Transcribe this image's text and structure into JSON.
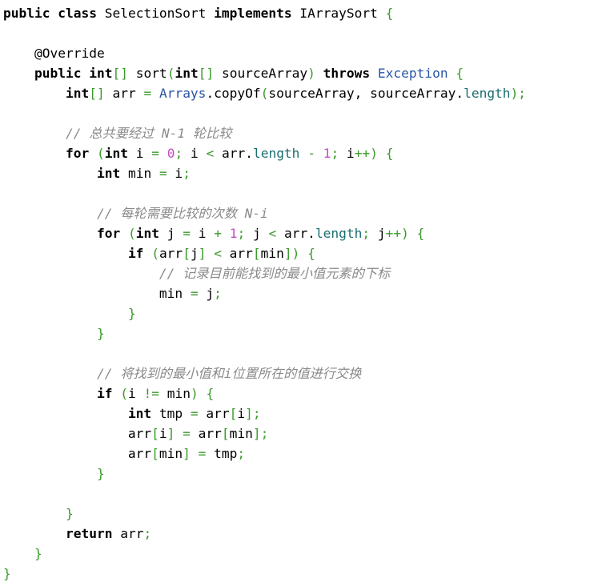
{
  "document": {
    "language": "java",
    "lines": [
      [
        [
          "kw",
          "public"
        ],
        [
          "id",
          " "
        ],
        [
          "kw",
          "class"
        ],
        [
          "id",
          " SelectionSort "
        ],
        [
          "kw",
          "implements"
        ],
        [
          "id",
          " IArraySort "
        ],
        [
          "pn",
          "{"
        ]
      ],
      [],
      [
        [
          "id",
          "    "
        ],
        [
          "an",
          "@Override"
        ]
      ],
      [
        [
          "id",
          "    "
        ],
        [
          "kw",
          "public"
        ],
        [
          "id",
          " "
        ],
        [
          "kw",
          "int"
        ],
        [
          "pn",
          "[]"
        ],
        [
          "id",
          " sort"
        ],
        [
          "pn",
          "("
        ],
        [
          "kw",
          "int"
        ],
        [
          "pn",
          "[]"
        ],
        [
          "id",
          " sourceArray"
        ],
        [
          "pn",
          ")"
        ],
        [
          "id",
          " "
        ],
        [
          "kw",
          "throws"
        ],
        [
          "id",
          " "
        ],
        [
          "ty",
          "Exception"
        ],
        [
          "id",
          " "
        ],
        [
          "pn",
          "{"
        ]
      ],
      [
        [
          "id",
          "        "
        ],
        [
          "kw",
          "int"
        ],
        [
          "pn",
          "[]"
        ],
        [
          "id",
          " arr "
        ],
        [
          "op",
          "="
        ],
        [
          "id",
          " "
        ],
        [
          "ty",
          "Arrays"
        ],
        [
          "id",
          ".copyOf"
        ],
        [
          "pn",
          "("
        ],
        [
          "id",
          "sourceArray, sourceArray."
        ],
        [
          "fld",
          "length"
        ],
        [
          "pn",
          ");"
        ]
      ],
      [],
      [
        [
          "id",
          "        "
        ],
        [
          "cm",
          "// 总共要经过 N-1 轮比较"
        ]
      ],
      [
        [
          "id",
          "        "
        ],
        [
          "kw",
          "for"
        ],
        [
          "id",
          " "
        ],
        [
          "pn",
          "("
        ],
        [
          "kw",
          "int"
        ],
        [
          "id",
          " i "
        ],
        [
          "op",
          "="
        ],
        [
          "id",
          " "
        ],
        [
          "num",
          "0"
        ],
        [
          "pn",
          ";"
        ],
        [
          "id",
          " i "
        ],
        [
          "op",
          "<"
        ],
        [
          "id",
          " arr."
        ],
        [
          "fld",
          "length"
        ],
        [
          "id",
          " "
        ],
        [
          "op",
          "-"
        ],
        [
          "id",
          " "
        ],
        [
          "num",
          "1"
        ],
        [
          "pn",
          ";"
        ],
        [
          "id",
          " i"
        ],
        [
          "op",
          "++"
        ],
        [
          "pn",
          ")"
        ],
        [
          "id",
          " "
        ],
        [
          "pn",
          "{"
        ]
      ],
      [
        [
          "id",
          "            "
        ],
        [
          "kw",
          "int"
        ],
        [
          "id",
          " min "
        ],
        [
          "op",
          "="
        ],
        [
          "id",
          " i"
        ],
        [
          "pn",
          ";"
        ]
      ],
      [],
      [
        [
          "id",
          "            "
        ],
        [
          "cm",
          "// 每轮需要比较的次数 N-i"
        ]
      ],
      [
        [
          "id",
          "            "
        ],
        [
          "kw",
          "for"
        ],
        [
          "id",
          " "
        ],
        [
          "pn",
          "("
        ],
        [
          "kw",
          "int"
        ],
        [
          "id",
          " j "
        ],
        [
          "op",
          "="
        ],
        [
          "id",
          " i "
        ],
        [
          "op",
          "+"
        ],
        [
          "id",
          " "
        ],
        [
          "num",
          "1"
        ],
        [
          "pn",
          ";"
        ],
        [
          "id",
          " j "
        ],
        [
          "op",
          "<"
        ],
        [
          "id",
          " arr."
        ],
        [
          "fld",
          "length"
        ],
        [
          "pn",
          ";"
        ],
        [
          "id",
          " j"
        ],
        [
          "op",
          "++"
        ],
        [
          "pn",
          ")"
        ],
        [
          "id",
          " "
        ],
        [
          "pn",
          "{"
        ]
      ],
      [
        [
          "id",
          "                "
        ],
        [
          "kw",
          "if"
        ],
        [
          "id",
          " "
        ],
        [
          "pn",
          "("
        ],
        [
          "id",
          "arr"
        ],
        [
          "pn",
          "["
        ],
        [
          "id",
          "j"
        ],
        [
          "pn",
          "]"
        ],
        [
          "id",
          " "
        ],
        [
          "op",
          "<"
        ],
        [
          "id",
          " arr"
        ],
        [
          "pn",
          "["
        ],
        [
          "id",
          "min"
        ],
        [
          "pn",
          "])"
        ],
        [
          "id",
          " "
        ],
        [
          "pn",
          "{"
        ]
      ],
      [
        [
          "id",
          "                    "
        ],
        [
          "cm",
          "// 记录目前能找到的最小值元素的下标"
        ]
      ],
      [
        [
          "id",
          "                    min "
        ],
        [
          "op",
          "="
        ],
        [
          "id",
          " j"
        ],
        [
          "pn",
          ";"
        ]
      ],
      [
        [
          "id",
          "                "
        ],
        [
          "pn",
          "}"
        ]
      ],
      [
        [
          "id",
          "            "
        ],
        [
          "pn",
          "}"
        ]
      ],
      [],
      [
        [
          "id",
          "            "
        ],
        [
          "cm",
          "// 将找到的最小值和i位置所在的值进行交换"
        ]
      ],
      [
        [
          "id",
          "            "
        ],
        [
          "kw",
          "if"
        ],
        [
          "id",
          " "
        ],
        [
          "pn",
          "("
        ],
        [
          "id",
          "i "
        ],
        [
          "op",
          "!="
        ],
        [
          "id",
          " min"
        ],
        [
          "pn",
          ")"
        ],
        [
          "id",
          " "
        ],
        [
          "pn",
          "{"
        ]
      ],
      [
        [
          "id",
          "                "
        ],
        [
          "kw",
          "int"
        ],
        [
          "id",
          " tmp "
        ],
        [
          "op",
          "="
        ],
        [
          "id",
          " arr"
        ],
        [
          "pn",
          "["
        ],
        [
          "id",
          "i"
        ],
        [
          "pn",
          "];"
        ]
      ],
      [
        [
          "id",
          "                arr"
        ],
        [
          "pn",
          "["
        ],
        [
          "id",
          "i"
        ],
        [
          "pn",
          "]"
        ],
        [
          "id",
          " "
        ],
        [
          "op",
          "="
        ],
        [
          "id",
          " arr"
        ],
        [
          "pn",
          "["
        ],
        [
          "id",
          "min"
        ],
        [
          "pn",
          "];"
        ]
      ],
      [
        [
          "id",
          "                arr"
        ],
        [
          "pn",
          "["
        ],
        [
          "id",
          "min"
        ],
        [
          "pn",
          "]"
        ],
        [
          "id",
          " "
        ],
        [
          "op",
          "="
        ],
        [
          "id",
          " tmp"
        ],
        [
          "pn",
          ";"
        ]
      ],
      [
        [
          "id",
          "            "
        ],
        [
          "pn",
          "}"
        ]
      ],
      [],
      [
        [
          "id",
          "        "
        ],
        [
          "pn",
          "}"
        ]
      ],
      [
        [
          "id",
          "        "
        ],
        [
          "kw",
          "return"
        ],
        [
          "id",
          " arr"
        ],
        [
          "pn",
          ";"
        ]
      ],
      [
        [
          "id",
          "    "
        ],
        [
          "pn",
          "}"
        ]
      ],
      [
        [
          "pn",
          "}"
        ]
      ]
    ]
  },
  "colors": {
    "keyword": "#000000",
    "type": "#2a55a6",
    "field": "#1a6e6e",
    "punctuation": "#3a9a2a",
    "number": "#c34ec3",
    "comment": "#8a8a8a",
    "background": "#ffffff"
  }
}
